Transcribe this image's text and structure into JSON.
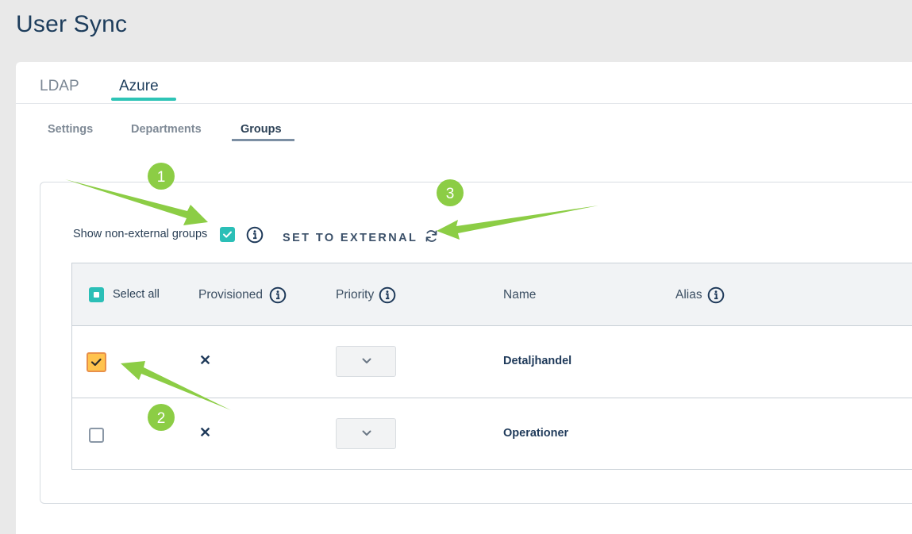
{
  "page": {
    "title": "User Sync"
  },
  "tabs": [
    {
      "label": "LDAP",
      "active": false
    },
    {
      "label": "Azure",
      "active": true
    }
  ],
  "subtabs": [
    {
      "label": "Settings",
      "active": false
    },
    {
      "label": "Departments",
      "active": false
    },
    {
      "label": "Groups",
      "active": true
    }
  ],
  "toolbar": {
    "show_non_external_label": "Show non-external groups",
    "show_non_external_checked": true,
    "set_external_label": "SET TO EXTERNAL"
  },
  "table": {
    "select_all_label": "Select all",
    "columns": [
      "Provisioned",
      "Priority",
      "Name",
      "Alias"
    ],
    "rows": [
      {
        "checked": true,
        "provisioned": "✕",
        "name": "Detaljhandel"
      },
      {
        "checked": false,
        "provisioned": "✕",
        "name": "Operationer"
      }
    ]
  },
  "annotations": [
    {
      "number": "1"
    },
    {
      "number": "2"
    },
    {
      "number": "3"
    }
  ],
  "colors": {
    "accent": "#2ec4b6",
    "annotation_green": "#8ccd45",
    "title": "#1d3d5c"
  }
}
